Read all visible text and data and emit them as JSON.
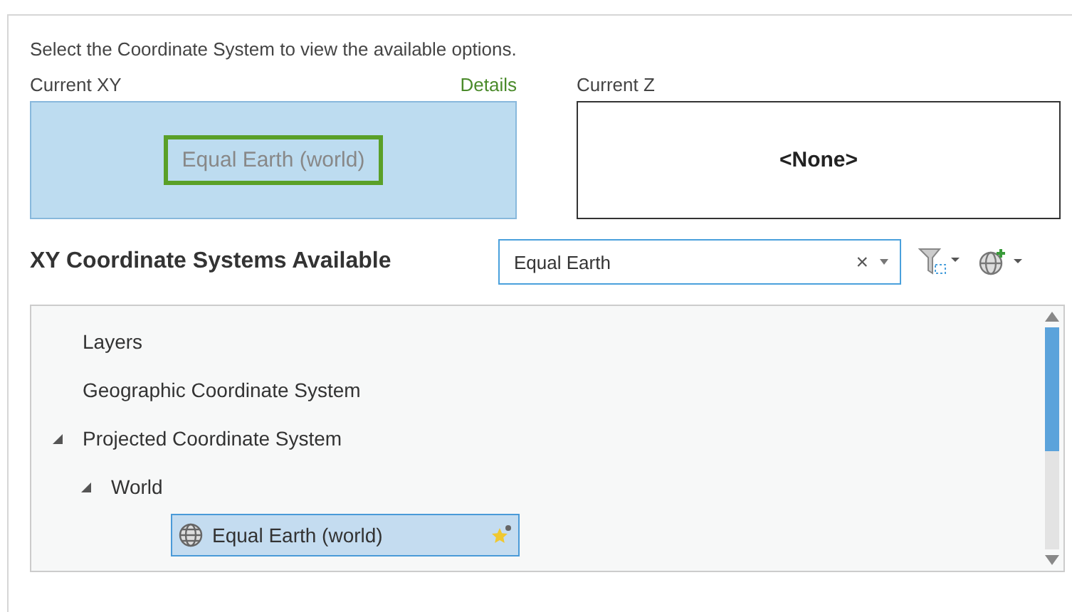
{
  "instruction": "Select the Coordinate System to view the available options.",
  "current_xy": {
    "label": "Current XY",
    "link": "Details",
    "value": "Equal Earth (world)",
    "selected": true
  },
  "current_z": {
    "label": "Current Z",
    "value": "<None>",
    "selected": false
  },
  "available": {
    "heading": "XY Coordinate Systems Available",
    "search": {
      "value": "Equal Earth",
      "clear": "×"
    }
  },
  "tree": [
    {
      "label": "Layers",
      "selected": false
    },
    {
      "label": "Geographic Coordinate System",
      "selected": false
    },
    {
      "label": "Projected Coordinate System",
      "expanded": true,
      "selected": false,
      "children": [
        {
          "label": "World",
          "expanded": true,
          "selected": false,
          "children": [
            {
              "label": "Equal Earth (world)",
              "kind": "leaf",
              "selected": true,
              "favorite": true
            }
          ]
        }
      ]
    }
  ]
}
